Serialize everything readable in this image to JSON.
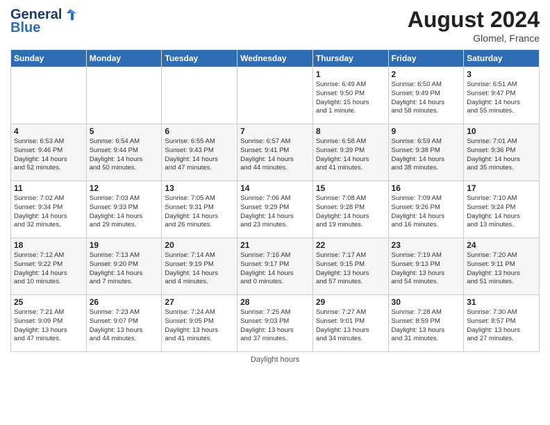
{
  "header": {
    "logo_line1": "General",
    "logo_line2": "Blue",
    "month_year": "August 2024",
    "location": "Glomel, France"
  },
  "days_of_week": [
    "Sunday",
    "Monday",
    "Tuesday",
    "Wednesday",
    "Thursday",
    "Friday",
    "Saturday"
  ],
  "weeks": [
    [
      {
        "day": "",
        "info": ""
      },
      {
        "day": "",
        "info": ""
      },
      {
        "day": "",
        "info": ""
      },
      {
        "day": "",
        "info": ""
      },
      {
        "day": "1",
        "info": "Sunrise: 6:49 AM\nSunset: 9:50 PM\nDaylight: 15 hours\nand 1 minute."
      },
      {
        "day": "2",
        "info": "Sunrise: 6:50 AM\nSunset: 9:49 PM\nDaylight: 14 hours\nand 58 minutes."
      },
      {
        "day": "3",
        "info": "Sunrise: 6:51 AM\nSunset: 9:47 PM\nDaylight: 14 hours\nand 55 minutes."
      }
    ],
    [
      {
        "day": "4",
        "info": "Sunrise: 6:53 AM\nSunset: 9:46 PM\nDaylight: 14 hours\nand 52 minutes."
      },
      {
        "day": "5",
        "info": "Sunrise: 6:54 AM\nSunset: 9:44 PM\nDaylight: 14 hours\nand 50 minutes."
      },
      {
        "day": "6",
        "info": "Sunrise: 6:55 AM\nSunset: 9:43 PM\nDaylight: 14 hours\nand 47 minutes."
      },
      {
        "day": "7",
        "info": "Sunrise: 6:57 AM\nSunset: 9:41 PM\nDaylight: 14 hours\nand 44 minutes."
      },
      {
        "day": "8",
        "info": "Sunrise: 6:58 AM\nSunset: 9:39 PM\nDaylight: 14 hours\nand 41 minutes."
      },
      {
        "day": "9",
        "info": "Sunrise: 6:59 AM\nSunset: 9:38 PM\nDaylight: 14 hours\nand 38 minutes."
      },
      {
        "day": "10",
        "info": "Sunrise: 7:01 AM\nSunset: 9:36 PM\nDaylight: 14 hours\nand 35 minutes."
      }
    ],
    [
      {
        "day": "11",
        "info": "Sunrise: 7:02 AM\nSunset: 9:34 PM\nDaylight: 14 hours\nand 32 minutes."
      },
      {
        "day": "12",
        "info": "Sunrise: 7:03 AM\nSunset: 9:33 PM\nDaylight: 14 hours\nand 29 minutes."
      },
      {
        "day": "13",
        "info": "Sunrise: 7:05 AM\nSunset: 9:31 PM\nDaylight: 14 hours\nand 26 minutes."
      },
      {
        "day": "14",
        "info": "Sunrise: 7:06 AM\nSunset: 9:29 PM\nDaylight: 14 hours\nand 23 minutes."
      },
      {
        "day": "15",
        "info": "Sunrise: 7:08 AM\nSunset: 9:28 PM\nDaylight: 14 hours\nand 19 minutes."
      },
      {
        "day": "16",
        "info": "Sunrise: 7:09 AM\nSunset: 9:26 PM\nDaylight: 14 hours\nand 16 minutes."
      },
      {
        "day": "17",
        "info": "Sunrise: 7:10 AM\nSunset: 9:24 PM\nDaylight: 14 hours\nand 13 minutes."
      }
    ],
    [
      {
        "day": "18",
        "info": "Sunrise: 7:12 AM\nSunset: 9:22 PM\nDaylight: 14 hours\nand 10 minutes."
      },
      {
        "day": "19",
        "info": "Sunrise: 7:13 AM\nSunset: 9:20 PM\nDaylight: 14 hours\nand 7 minutes."
      },
      {
        "day": "20",
        "info": "Sunrise: 7:14 AM\nSunset: 9:19 PM\nDaylight: 14 hours\nand 4 minutes."
      },
      {
        "day": "21",
        "info": "Sunrise: 7:16 AM\nSunset: 9:17 PM\nDaylight: 14 hours\nand 0 minutes."
      },
      {
        "day": "22",
        "info": "Sunrise: 7:17 AM\nSunset: 9:15 PM\nDaylight: 13 hours\nand 57 minutes."
      },
      {
        "day": "23",
        "info": "Sunrise: 7:19 AM\nSunset: 9:13 PM\nDaylight: 13 hours\nand 54 minutes."
      },
      {
        "day": "24",
        "info": "Sunrise: 7:20 AM\nSunset: 9:11 PM\nDaylight: 13 hours\nand 51 minutes."
      }
    ],
    [
      {
        "day": "25",
        "info": "Sunrise: 7:21 AM\nSunset: 9:09 PM\nDaylight: 13 hours\nand 47 minutes."
      },
      {
        "day": "26",
        "info": "Sunrise: 7:23 AM\nSunset: 9:07 PM\nDaylight: 13 hours\nand 44 minutes."
      },
      {
        "day": "27",
        "info": "Sunrise: 7:24 AM\nSunset: 9:05 PM\nDaylight: 13 hours\nand 41 minutes."
      },
      {
        "day": "28",
        "info": "Sunrise: 7:25 AM\nSunset: 9:03 PM\nDaylight: 13 hours\nand 37 minutes."
      },
      {
        "day": "29",
        "info": "Sunrise: 7:27 AM\nSunset: 9:01 PM\nDaylight: 13 hours\nand 34 minutes."
      },
      {
        "day": "30",
        "info": "Sunrise: 7:28 AM\nSunset: 8:59 PM\nDaylight: 13 hours\nand 31 minutes."
      },
      {
        "day": "31",
        "info": "Sunrise: 7:30 AM\nSunset: 8:57 PM\nDaylight: 13 hours\nand 27 minutes."
      }
    ]
  ],
  "footer": "Daylight hours"
}
